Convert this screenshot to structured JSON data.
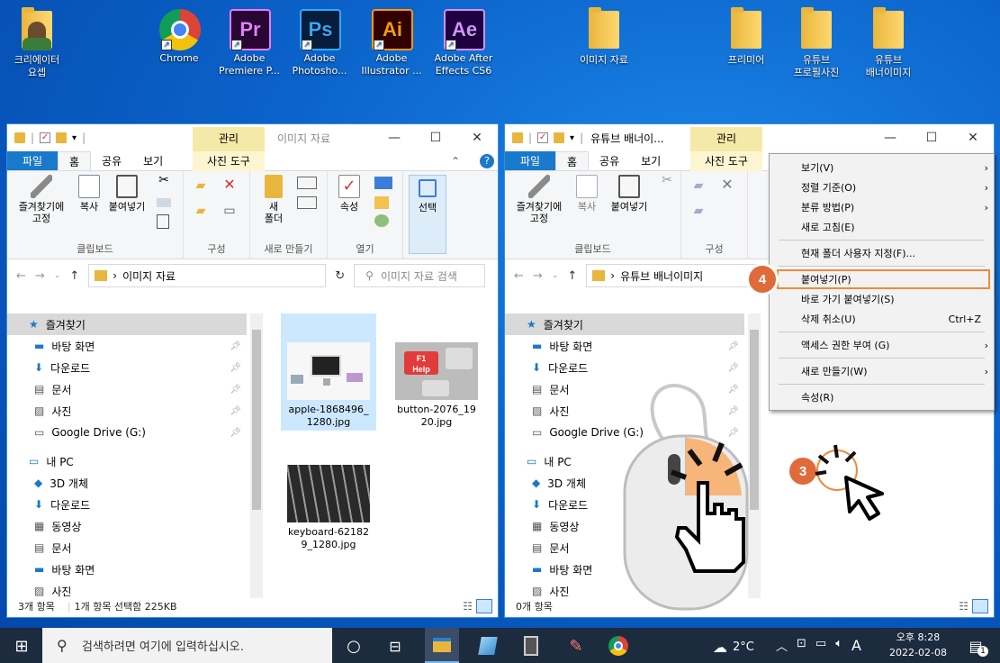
{
  "desktop": {
    "icons": [
      {
        "label1": "크리에이터",
        "label2": "요셉",
        "icon": "user-folder-icon"
      },
      {
        "label1": "Chrome",
        "label2": "",
        "icon": "chrome-icon"
      },
      {
        "label1": "Adobe",
        "label2": "Premiere P...",
        "icon": "premiere-icon",
        "abbr": "Pr"
      },
      {
        "label1": "Adobe",
        "label2": "Photosho...",
        "icon": "photoshop-icon",
        "abbr": "Ps"
      },
      {
        "label1": "Adobe",
        "label2": "Illustrator ...",
        "icon": "illustrator-icon",
        "abbr": "Ai"
      },
      {
        "label1": "Adobe After",
        "label2": "Effects CS6",
        "icon": "after-effects-icon",
        "abbr": "Ae"
      },
      {
        "label1": "이미지 자료",
        "label2": "",
        "icon": "folder-icon"
      },
      {
        "label1": "프리미어",
        "label2": "",
        "icon": "folder-icon"
      },
      {
        "label1": "유튜브",
        "label2": "프로필사진",
        "icon": "folder-icon"
      },
      {
        "label1": "유튜브",
        "label2": "배너이미지",
        "icon": "folder-icon"
      }
    ]
  },
  "left_window": {
    "title": "이미지 자료",
    "context_tab": "관리",
    "context_subtab": "사진 도구",
    "tabs": [
      "파일",
      "홈",
      "공유",
      "보기"
    ],
    "ribbon": {
      "pin_label1": "즐겨찾기에",
      "pin_label2": "고정",
      "copy": "복사",
      "paste": "붙여넣기",
      "group_clipboard": "클립보드",
      "group_organize": "구성",
      "new_folder1": "새",
      "new_folder2": "폴더",
      "group_new": "새로 만들기",
      "properties": "속성",
      "group_open": "열기",
      "select": "선택"
    },
    "address": "이미지 자료",
    "search_placeholder": "이미지 자료 검색",
    "nav": [
      "즐겨찾기",
      "바탕 화면",
      "다운로드",
      "문서",
      "사진",
      "Google Drive (G:)",
      "내 PC",
      "3D 개체",
      "다운로드",
      "동영상",
      "문서",
      "바탕 화면",
      "사진"
    ],
    "files": [
      {
        "name1": "apple-1868496_",
        "name2": "1280.jpg"
      },
      {
        "name1": "button-2076_19",
        "name2": "20.jpg"
      },
      {
        "name1": "keyboard-62182",
        "name2": "9_1280.jpg"
      }
    ],
    "status_count": "3개 항목",
    "status_selected": "1개 항목 선택함 225KB"
  },
  "right_window": {
    "title": "유튜브 배너이...",
    "context_tab": "관리",
    "context_subtab": "사진 도구",
    "tabs": [
      "파일",
      "홈",
      "공유",
      "보기"
    ],
    "address": "유튜브 배너이미지",
    "nav": [
      "즐겨찾기",
      "바탕 화면",
      "다운로드",
      "문서",
      "사진",
      "Google Drive (G:)",
      "내 PC",
      "3D 개체",
      "다운로드",
      "동영상",
      "문서",
      "바탕 화면",
      "사진"
    ],
    "status_count": "0개 항목"
  },
  "context_menu": {
    "items": [
      {
        "label": "보기(V)",
        "arrow": true
      },
      {
        "label": "정렬 기준(O)",
        "arrow": true
      },
      {
        "label": "분류 방법(P)",
        "arrow": true
      },
      {
        "label": "새로 고침(E)",
        "arrow": false
      },
      {
        "sep": true
      },
      {
        "label": "현재 폴더 사용자 지정(F)...",
        "arrow": false
      },
      {
        "sep": true
      },
      {
        "label": "붙여넣기(P)",
        "arrow": false,
        "highlight": true
      },
      {
        "label": "바로 가기 붙여넣기(S)",
        "arrow": false
      },
      {
        "label": "삭제 취소(U)",
        "shortcut": "Ctrl+Z",
        "arrow": false
      },
      {
        "sep": true
      },
      {
        "label": "액세스 권한 부여 (G)",
        "arrow": true
      },
      {
        "sep": true
      },
      {
        "label": "새로 만들기(W)",
        "arrow": true
      },
      {
        "sep": true
      },
      {
        "label": "속성(R)",
        "arrow": false
      }
    ]
  },
  "annotations": {
    "step3": "3",
    "step4": "4"
  },
  "taskbar": {
    "search_placeholder": "검색하려면 여기에 입력하십시오.",
    "weather": "2°C",
    "ime": "A",
    "time": "오후 8:28",
    "date": "2022-02-08",
    "notification_count": "1"
  },
  "colors": {
    "accent": "#1979ca",
    "highlight": "#f08a3a",
    "badge": "#e06b3a",
    "taskbar": "#1c2b3e"
  }
}
